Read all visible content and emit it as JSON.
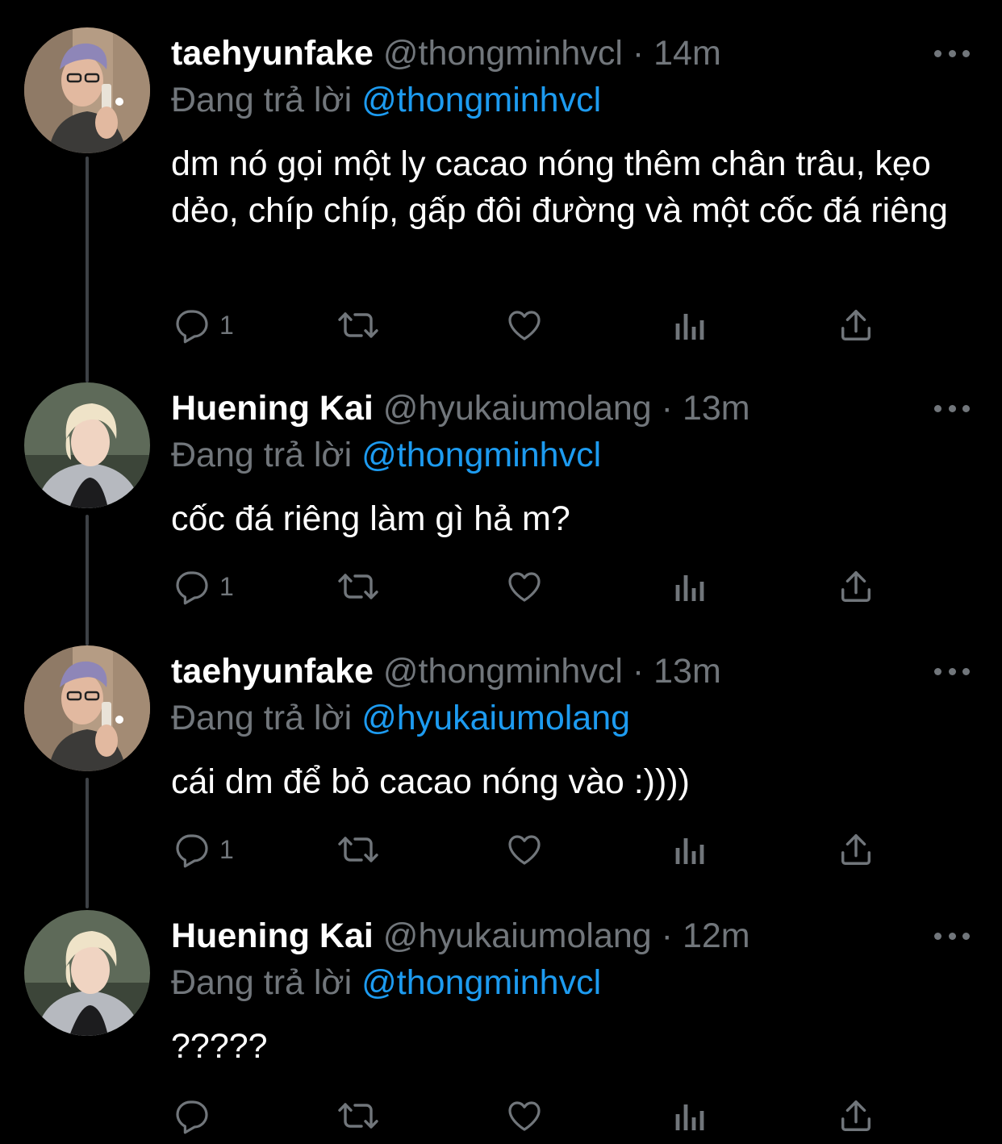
{
  "tweets": [
    {
      "display_name": "taehyunfake",
      "handle": "@thongminhvcl",
      "separator": "·",
      "time": "14m",
      "reply_prefix": "Đang trả lời",
      "reply_to": "@thongminhvcl",
      "text": "dm nó gọi một ly cacao nóng thêm chân trâu, kẹo dẻo, chíp chíp, gấp đôi đường và một cốc đá riêng",
      "reply_count": "1",
      "avatar": "avatar-taehyunfake"
    },
    {
      "display_name": "Huening Kai",
      "handle": "@hyukaiumolang",
      "separator": "·",
      "time": "13m",
      "reply_prefix": "Đang trả lời",
      "reply_to": "@thongminhvcl",
      "text": "cốc đá riêng làm gì hả m?",
      "reply_count": "1",
      "avatar": "avatar-hueningkai"
    },
    {
      "display_name": "taehyunfake",
      "handle": "@thongminhvcl",
      "separator": "·",
      "time": "13m",
      "reply_prefix": "Đang trả lời",
      "reply_to": "@hyukaiumolang",
      "text": "cái dm để bỏ cacao nóng vào :))))",
      "reply_count": "1",
      "avatar": "avatar-taehyunfake"
    },
    {
      "display_name": "Huening Kai",
      "handle": "@hyukaiumolang",
      "separator": "·",
      "time": "12m",
      "reply_prefix": "Đang trả lời",
      "reply_to": "@thongminhvcl",
      "text": "?????",
      "reply_count": "",
      "avatar": "avatar-hueningkai"
    }
  ],
  "icons": {
    "reply": "reply-icon",
    "retweet": "retweet-icon",
    "like": "heart-icon",
    "analytics": "analytics-icon",
    "share": "share-icon",
    "more": "more-icon"
  },
  "colors": {
    "background": "#000000",
    "primary_text": "#ffffff",
    "secondary_text": "#71767b",
    "mention": "#1d9bf0",
    "thread_line": "#3d4146"
  }
}
